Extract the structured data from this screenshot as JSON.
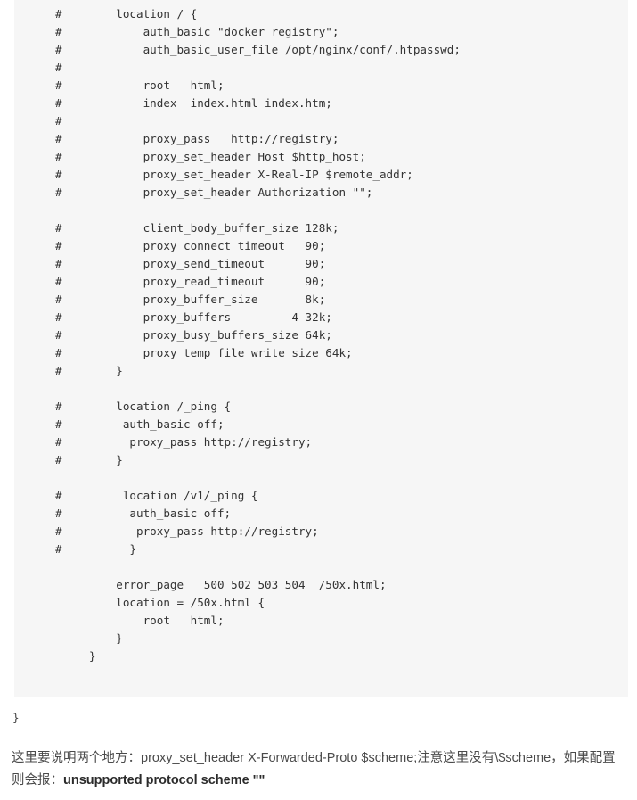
{
  "code_block": {
    "language": "nginx-conf",
    "background": "#f6f6f6",
    "text_color": "#333333",
    "lines": [
      "#        location / {",
      "#            auth_basic \"docker registry\";",
      "#            auth_basic_user_file /opt/nginx/conf/.htpasswd;",
      "#",
      "#            root   html;",
      "#            index  index.html index.htm;",
      "#",
      "#            proxy_pass   http://registry;",
      "#            proxy_set_header Host $http_host;",
      "#            proxy_set_header X-Real-IP $remote_addr;",
      "#            proxy_set_header Authorization \"\";",
      "",
      "#            client_body_buffer_size 128k;",
      "#            proxy_connect_timeout   90;",
      "#            proxy_send_timeout      90;",
      "#            proxy_read_timeout      90;",
      "#            proxy_buffer_size       8k;",
      "#            proxy_buffers         4 32k;",
      "#            proxy_busy_buffers_size 64k;",
      "#            proxy_temp_file_write_size 64k;",
      "#        }",
      "",
      "#        location /_ping {",
      "#         auth_basic off;",
      "#          proxy_pass http://registry;",
      "#        }",
      "",
      "#         location /v1/_ping {",
      "#          auth_basic off;",
      "#           proxy_pass http://registry;",
      "#          }",
      "",
      "         error_page   500 502 503 504  /50x.html;",
      "         location = /50x.html {",
      "             root   html;",
      "         }",
      "     }"
    ]
  },
  "orphan_brace": {
    "text": "}"
  },
  "prose": {
    "line1_prefix": "这里要说明两个地方：",
    "line1_code": "proxy_set_header X-Forwarded-Proto $scheme;",
    "line1_mid": "注意这里没有\\$scheme，如果配置则会报：",
    "line1_bold": "unsupported protocol scheme \"\"",
    "full_text": "这里要说明两个地方：proxy_set_header X-Forwarded-Proto $scheme;注意这里没有\\$scheme，如果配置则会报：unsupported protocol scheme \"\""
  }
}
